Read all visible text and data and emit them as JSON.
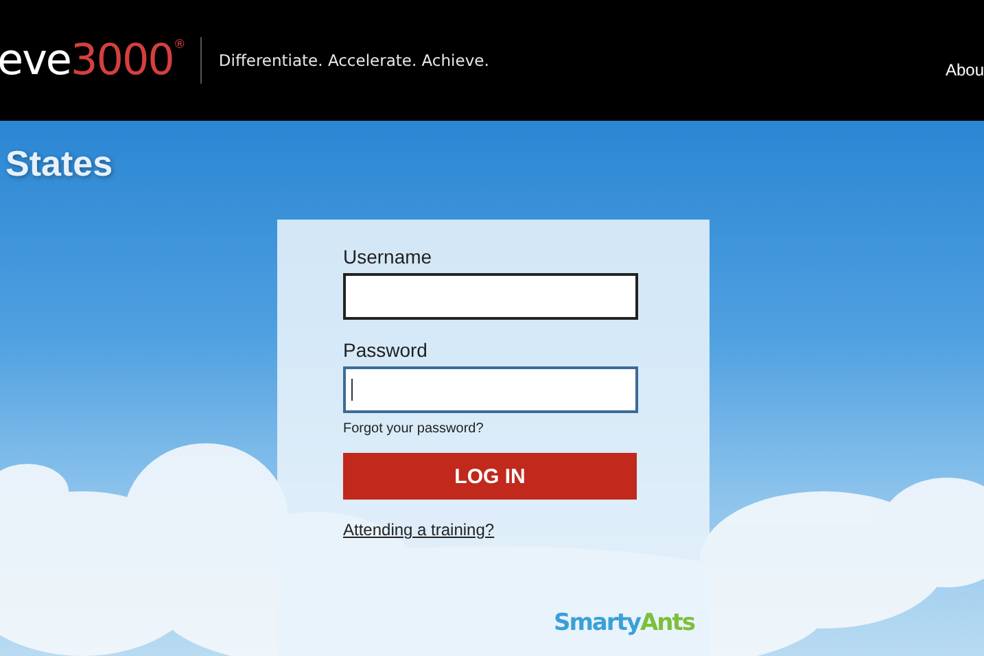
{
  "header": {
    "logo": {
      "prefix": "eve",
      "number": "3000",
      "mark": "®"
    },
    "tagline": "Differentiate. Accelerate. Achieve.",
    "nav": [
      "Abou"
    ]
  },
  "page_title": "States",
  "login": {
    "fields": [
      {
        "label": "Username",
        "focused": false
      },
      {
        "label": "Password",
        "focused": true
      }
    ],
    "forgot_link": "Forgot your password?",
    "submit": "LOG IN",
    "training_link": "Attending a training?",
    "brand": {
      "first": "Smarty",
      "second": "Ants"
    }
  }
}
